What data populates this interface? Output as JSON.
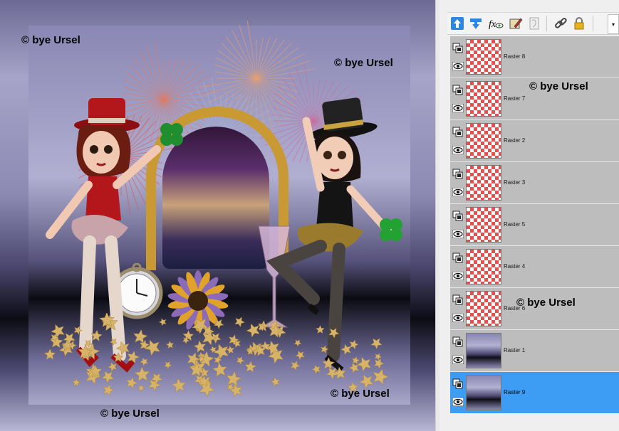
{
  "canvas": {
    "watermarks": [
      "© bye Ursel",
      "© bye Ursel",
      "© bye Ursel",
      "© bye Ursel"
    ]
  },
  "layers_palette": {
    "toolbar": {
      "buttons": [
        {
          "icon": "move-layer-up-icon"
        },
        {
          "icon": "move-layer-down-icon"
        },
        {
          "icon": "layer-effects-icon"
        },
        {
          "icon": "edit-selection-icon"
        },
        {
          "icon": "mask-icon"
        },
        {
          "icon": "link-icon"
        },
        {
          "icon": "lock-icon"
        }
      ],
      "menu_glyph": "▾"
    },
    "layers": [
      {
        "name": "Raster 8",
        "selected": false,
        "kind": "transparent"
      },
      {
        "name": "Raster 7",
        "selected": false,
        "kind": "transparent"
      },
      {
        "name": "Raster 2",
        "selected": false,
        "kind": "transparent"
      },
      {
        "name": "Raster 3",
        "selected": false,
        "kind": "transparent"
      },
      {
        "name": "Raster 5",
        "selected": false,
        "kind": "transparent"
      },
      {
        "name": "Raster 4",
        "selected": false,
        "kind": "transparent"
      },
      {
        "name": "Raster 6",
        "selected": false,
        "kind": "transparent"
      },
      {
        "name": "Raster 1",
        "selected": false,
        "kind": "background"
      },
      {
        "name": "Raster 9",
        "selected": true,
        "kind": "background"
      }
    ],
    "watermarks": [
      "© bye Ursel",
      "© bye Ursel"
    ]
  },
  "colors": {
    "selection": "#3d9df5",
    "row": "#bdbdbd",
    "checker": "#e45050"
  }
}
